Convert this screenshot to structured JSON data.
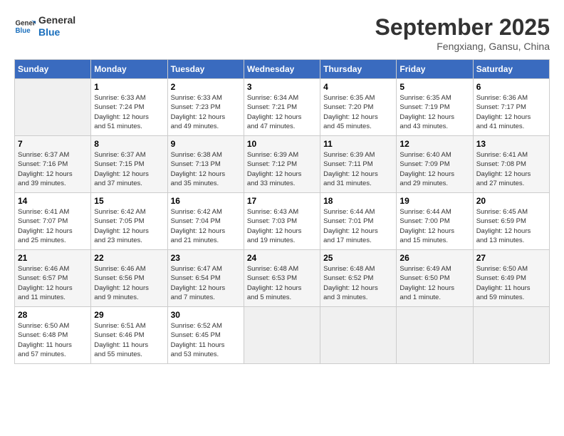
{
  "logo": {
    "line1": "General",
    "line2": "Blue"
  },
  "title": "September 2025",
  "subtitle": "Fengxiang, Gansu, China",
  "weekdays": [
    "Sunday",
    "Monday",
    "Tuesday",
    "Wednesday",
    "Thursday",
    "Friday",
    "Saturday"
  ],
  "weeks": [
    [
      {
        "day": "",
        "info": ""
      },
      {
        "day": "1",
        "info": "Sunrise: 6:33 AM\nSunset: 7:24 PM\nDaylight: 12 hours\nand 51 minutes."
      },
      {
        "day": "2",
        "info": "Sunrise: 6:33 AM\nSunset: 7:23 PM\nDaylight: 12 hours\nand 49 minutes."
      },
      {
        "day": "3",
        "info": "Sunrise: 6:34 AM\nSunset: 7:21 PM\nDaylight: 12 hours\nand 47 minutes."
      },
      {
        "day": "4",
        "info": "Sunrise: 6:35 AM\nSunset: 7:20 PM\nDaylight: 12 hours\nand 45 minutes."
      },
      {
        "day": "5",
        "info": "Sunrise: 6:35 AM\nSunset: 7:19 PM\nDaylight: 12 hours\nand 43 minutes."
      },
      {
        "day": "6",
        "info": "Sunrise: 6:36 AM\nSunset: 7:17 PM\nDaylight: 12 hours\nand 41 minutes."
      }
    ],
    [
      {
        "day": "7",
        "info": "Sunrise: 6:37 AM\nSunset: 7:16 PM\nDaylight: 12 hours\nand 39 minutes."
      },
      {
        "day": "8",
        "info": "Sunrise: 6:37 AM\nSunset: 7:15 PM\nDaylight: 12 hours\nand 37 minutes."
      },
      {
        "day": "9",
        "info": "Sunrise: 6:38 AM\nSunset: 7:13 PM\nDaylight: 12 hours\nand 35 minutes."
      },
      {
        "day": "10",
        "info": "Sunrise: 6:39 AM\nSunset: 7:12 PM\nDaylight: 12 hours\nand 33 minutes."
      },
      {
        "day": "11",
        "info": "Sunrise: 6:39 AM\nSunset: 7:11 PM\nDaylight: 12 hours\nand 31 minutes."
      },
      {
        "day": "12",
        "info": "Sunrise: 6:40 AM\nSunset: 7:09 PM\nDaylight: 12 hours\nand 29 minutes."
      },
      {
        "day": "13",
        "info": "Sunrise: 6:41 AM\nSunset: 7:08 PM\nDaylight: 12 hours\nand 27 minutes."
      }
    ],
    [
      {
        "day": "14",
        "info": "Sunrise: 6:41 AM\nSunset: 7:07 PM\nDaylight: 12 hours\nand 25 minutes."
      },
      {
        "day": "15",
        "info": "Sunrise: 6:42 AM\nSunset: 7:05 PM\nDaylight: 12 hours\nand 23 minutes."
      },
      {
        "day": "16",
        "info": "Sunrise: 6:42 AM\nSunset: 7:04 PM\nDaylight: 12 hours\nand 21 minutes."
      },
      {
        "day": "17",
        "info": "Sunrise: 6:43 AM\nSunset: 7:03 PM\nDaylight: 12 hours\nand 19 minutes."
      },
      {
        "day": "18",
        "info": "Sunrise: 6:44 AM\nSunset: 7:01 PM\nDaylight: 12 hours\nand 17 minutes."
      },
      {
        "day": "19",
        "info": "Sunrise: 6:44 AM\nSunset: 7:00 PM\nDaylight: 12 hours\nand 15 minutes."
      },
      {
        "day": "20",
        "info": "Sunrise: 6:45 AM\nSunset: 6:59 PM\nDaylight: 12 hours\nand 13 minutes."
      }
    ],
    [
      {
        "day": "21",
        "info": "Sunrise: 6:46 AM\nSunset: 6:57 PM\nDaylight: 12 hours\nand 11 minutes."
      },
      {
        "day": "22",
        "info": "Sunrise: 6:46 AM\nSunset: 6:56 PM\nDaylight: 12 hours\nand 9 minutes."
      },
      {
        "day": "23",
        "info": "Sunrise: 6:47 AM\nSunset: 6:54 PM\nDaylight: 12 hours\nand 7 minutes."
      },
      {
        "day": "24",
        "info": "Sunrise: 6:48 AM\nSunset: 6:53 PM\nDaylight: 12 hours\nand 5 minutes."
      },
      {
        "day": "25",
        "info": "Sunrise: 6:48 AM\nSunset: 6:52 PM\nDaylight: 12 hours\nand 3 minutes."
      },
      {
        "day": "26",
        "info": "Sunrise: 6:49 AM\nSunset: 6:50 PM\nDaylight: 12 hours\nand 1 minute."
      },
      {
        "day": "27",
        "info": "Sunrise: 6:50 AM\nSunset: 6:49 PM\nDaylight: 11 hours\nand 59 minutes."
      }
    ],
    [
      {
        "day": "28",
        "info": "Sunrise: 6:50 AM\nSunset: 6:48 PM\nDaylight: 11 hours\nand 57 minutes."
      },
      {
        "day": "29",
        "info": "Sunrise: 6:51 AM\nSunset: 6:46 PM\nDaylight: 11 hours\nand 55 minutes."
      },
      {
        "day": "30",
        "info": "Sunrise: 6:52 AM\nSunset: 6:45 PM\nDaylight: 11 hours\nand 53 minutes."
      },
      {
        "day": "",
        "info": ""
      },
      {
        "day": "",
        "info": ""
      },
      {
        "day": "",
        "info": ""
      },
      {
        "day": "",
        "info": ""
      }
    ]
  ]
}
